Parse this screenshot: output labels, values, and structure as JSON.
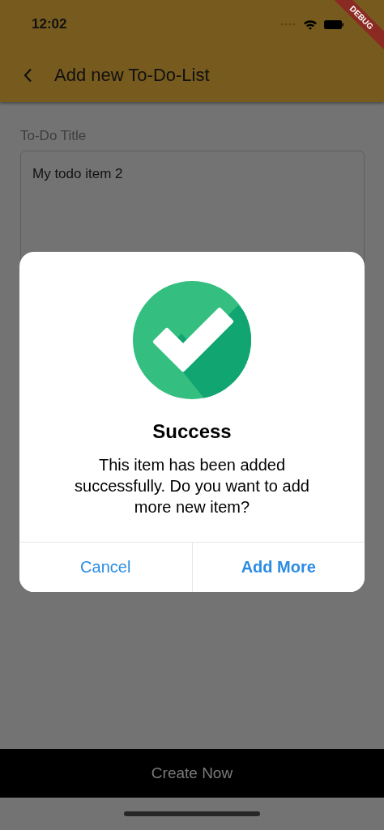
{
  "status_bar": {
    "time": "12:02"
  },
  "debug_banner": {
    "label": "DEBUG"
  },
  "app_bar": {
    "title": "Add new To-Do-List"
  },
  "form": {
    "label": "To-Do Title",
    "value": "My todo item 2"
  },
  "dialog": {
    "title": "Success",
    "message": "This item has been added successfully. Do you want to add more new item?",
    "buttons": [
      {
        "label": "Cancel",
        "kind": "default"
      },
      {
        "label": "Add More",
        "kind": "primary"
      }
    ]
  },
  "bottom_button": {
    "label": "Create Now"
  }
}
